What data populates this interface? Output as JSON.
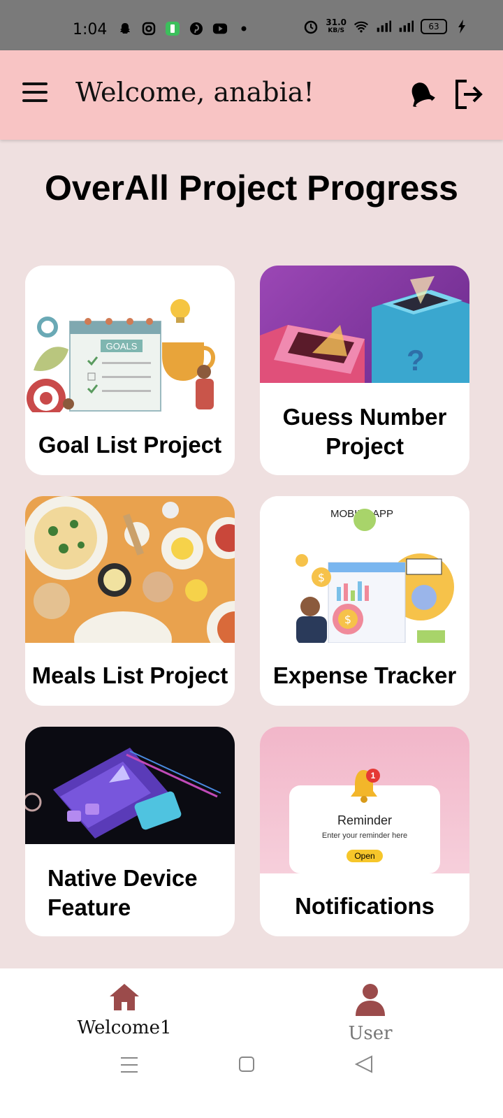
{
  "status_bar": {
    "time": "1:04",
    "speed_value": "31.0",
    "speed_unit": "KB/S",
    "battery": "63"
  },
  "app_bar": {
    "title": "Welcome, anabia!"
  },
  "page": {
    "title": "OverAll Project Progress"
  },
  "cards": [
    {
      "label": "Goal List Project",
      "image_text": "GOALS"
    },
    {
      "label_line1": "Guess Number",
      "label_line2": "Project",
      "image_text": "?"
    },
    {
      "label": "Meals List Project"
    },
    {
      "label": "Expense Tracker",
      "image_text": "MOBILE APP"
    },
    {
      "label_line1": "Native Device",
      "label_line2": "Feature"
    },
    {
      "label": "Notifications",
      "image_title": "Reminder",
      "image_subtitle": "Enter your reminder here",
      "image_button": "Open",
      "badge": "1"
    }
  ],
  "bottom_nav": {
    "items": [
      {
        "label": "Welcome1",
        "icon": "home-icon",
        "active": true
      },
      {
        "label": "User",
        "icon": "user-icon",
        "active": false
      }
    ]
  },
  "colors": {
    "app_bar": "#f8c4c4",
    "background": "#efe0e0",
    "nav_icon": "#9b4b4b"
  }
}
